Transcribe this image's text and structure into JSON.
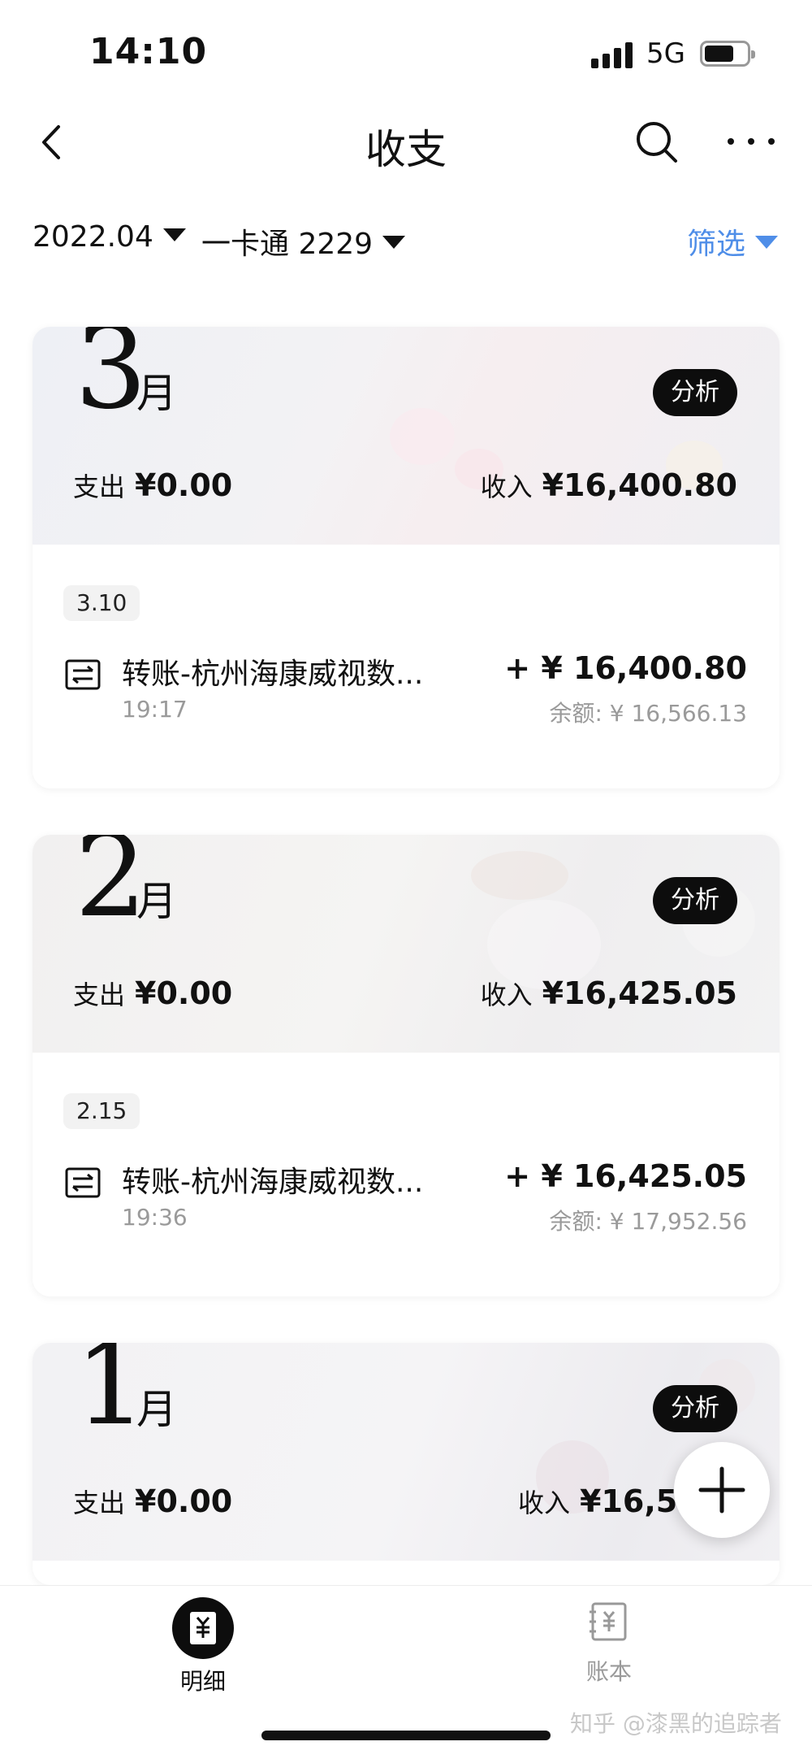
{
  "status_bar": {
    "time": "14:10",
    "network": "5G",
    "battery_level": 0.7
  },
  "nav": {
    "title": "收支"
  },
  "filters": {
    "date": "2022.04",
    "account": "一卡通 2229",
    "filter_label": "筛选"
  },
  "months": [
    {
      "number": "3",
      "unit": "月",
      "analyze_label": "分析",
      "expense_label": "支出",
      "expense": "¥0.00",
      "income_label": "收入",
      "income": "¥16,400.80",
      "transactions": [
        {
          "date": "3.10",
          "title": "转账-杭州海康威视数...",
          "time": "19:17",
          "amount": "+ ¥ 16,400.80",
          "balance": "余额: ¥ 16,566.13"
        }
      ]
    },
    {
      "number": "2",
      "unit": "月",
      "analyze_label": "分析",
      "expense_label": "支出",
      "expense": "¥0.00",
      "income_label": "收入",
      "income": "¥16,425.05",
      "transactions": [
        {
          "date": "2.15",
          "title": "转账-杭州海康威视数...",
          "time": "19:36",
          "amount": "+ ¥ 16,425.05",
          "balance": "余额: ¥ 17,952.56"
        }
      ]
    },
    {
      "number": "1",
      "unit": "月",
      "analyze_label": "分析",
      "expense_label": "支出",
      "expense": "¥0.00",
      "income_label": "收入",
      "income": "¥16,52"
    }
  ],
  "tabs": [
    {
      "label": "明细",
      "icon": "yuan-receipt-icon",
      "active": true
    },
    {
      "label": "账本",
      "icon": "ledger-icon",
      "active": false
    }
  ],
  "watermark": "知乎 @漆黑的追踪者",
  "colors": {
    "accent": "#4f8ee8",
    "analyze_bg": "#0d0d0d",
    "secondary_text": "#9a9a9a"
  }
}
